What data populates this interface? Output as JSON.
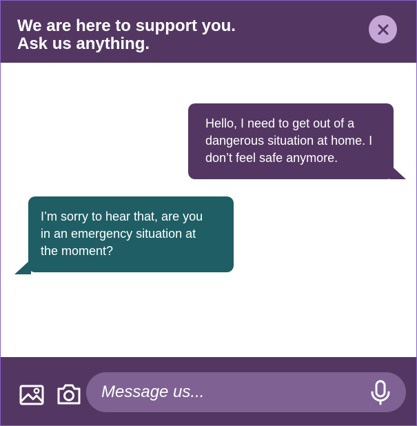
{
  "colors": {
    "header_bg": "#533762",
    "close_bg": "#c5a6d7",
    "user_bubble": "#533762",
    "agent_bubble": "#1e5e64",
    "input_bg": "#7f6293",
    "text": "#ffffff"
  },
  "header": {
    "title_line1": "We are here to support you.",
    "title_line2": "Ask us anything.",
    "close_icon": "close-icon"
  },
  "chat": {
    "messages": [
      {
        "from": "user",
        "lines": [
          "Hello, I need to get out of a",
          "dangerous situation at home. I",
          "don’t feel safe anymore."
        ]
      },
      {
        "from": "agent",
        "lines": [
          "I’m sorry to hear that, are you",
          "in an emergency situation at",
          "the moment?"
        ]
      }
    ]
  },
  "footer": {
    "gallery_icon": "image-icon",
    "camera_icon": "camera-icon",
    "mic_icon": "microphone-icon",
    "input": {
      "value": "",
      "placeholder": "Message us..."
    }
  }
}
